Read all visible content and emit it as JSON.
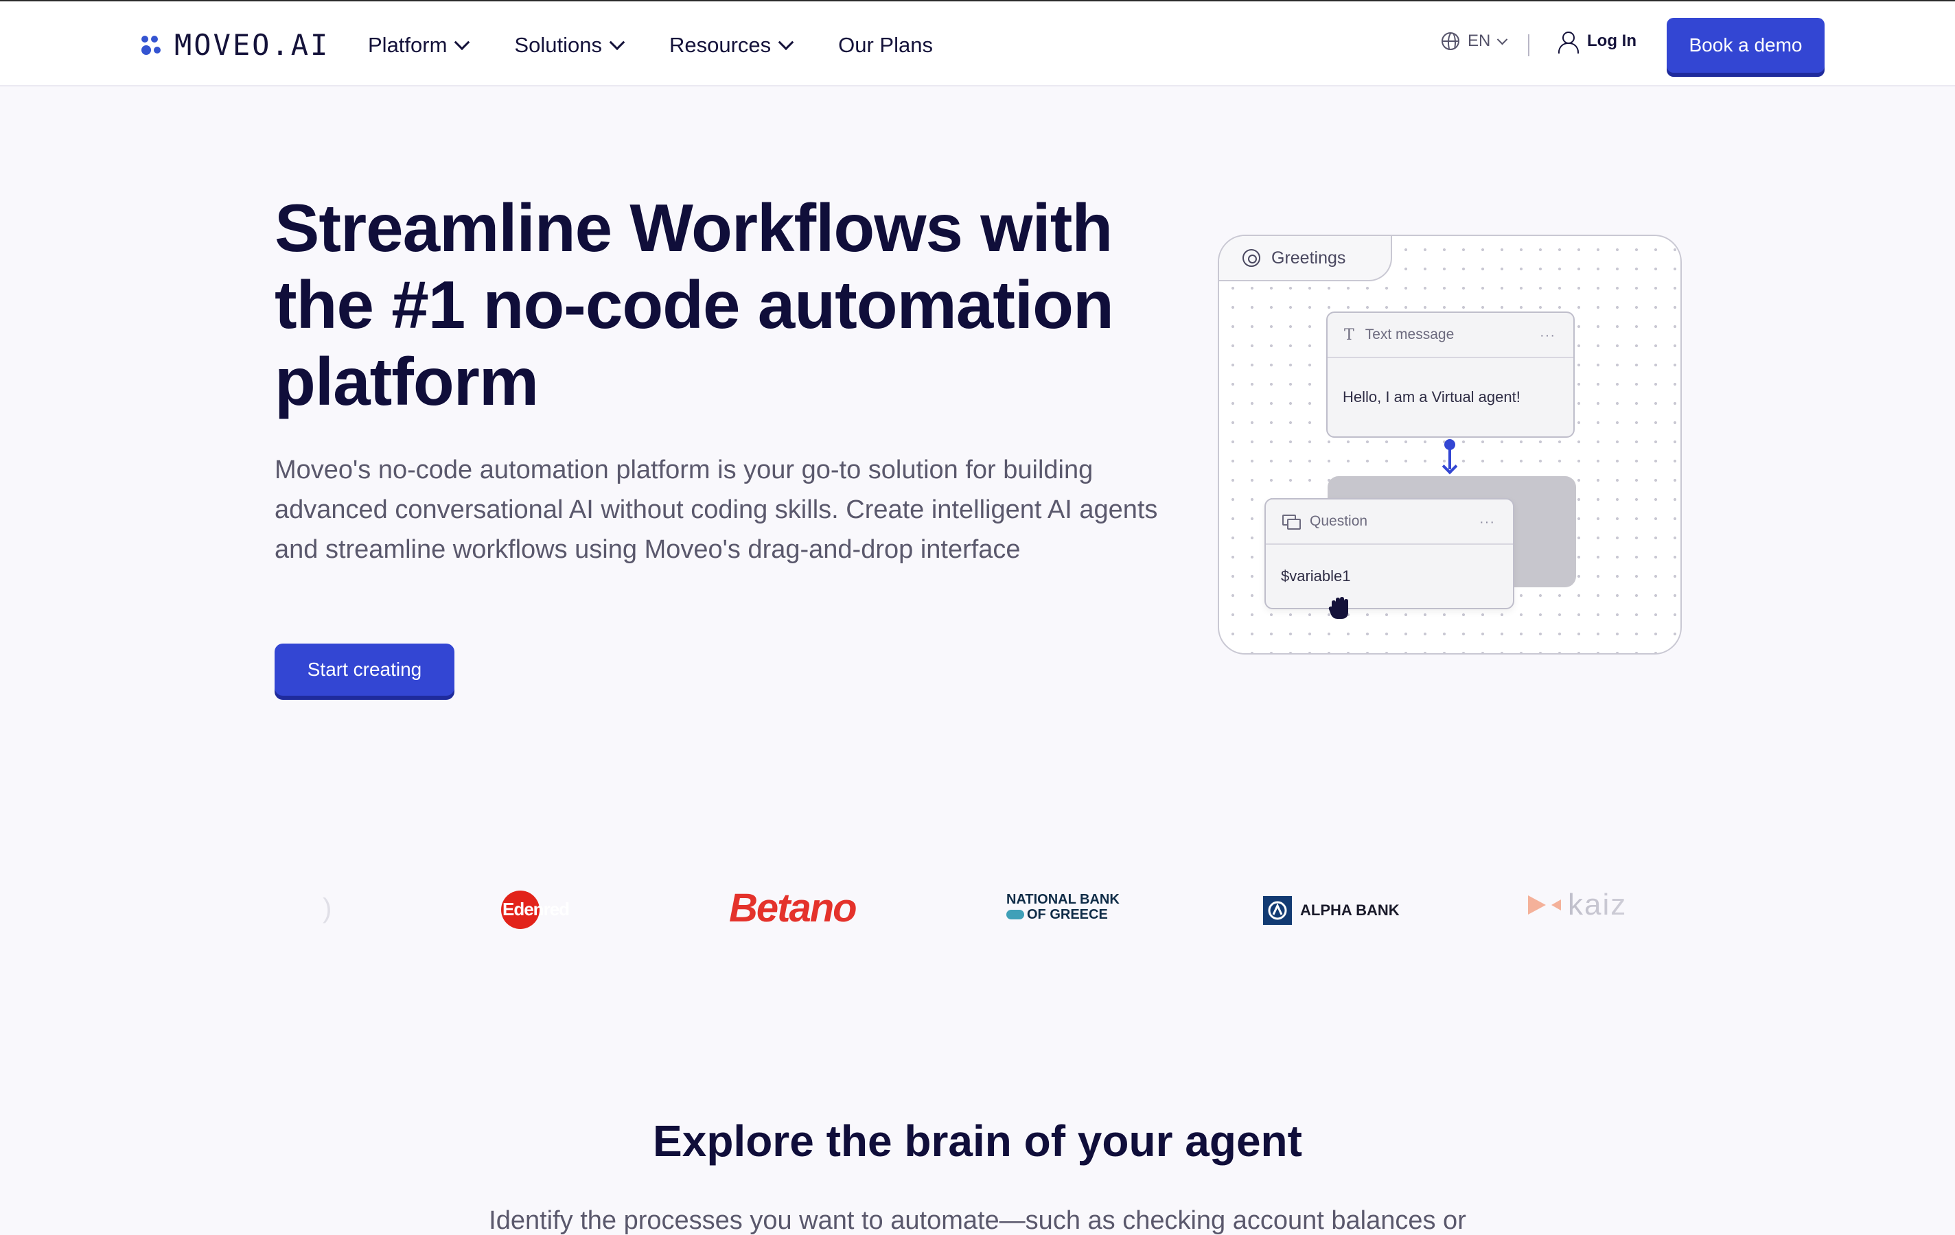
{
  "header": {
    "logo_text": "MOVEO.AI",
    "nav": [
      {
        "label": "Platform",
        "has_dropdown": true
      },
      {
        "label": "Solutions",
        "has_dropdown": true
      },
      {
        "label": "Resources",
        "has_dropdown": true
      },
      {
        "label": "Our Plans",
        "has_dropdown": false
      }
    ],
    "language": "EN",
    "login_label": "Log In",
    "cta_label": "Book a demo"
  },
  "hero": {
    "title": "Streamline Workflows with the #1 no-code automation platform",
    "description": "Moveo's no-code automation platform is your go-to solution for building advanced conversational AI without coding skills. Create intelligent AI agents and streamline workflows using Moveo's drag-and-drop interface",
    "cta_label": "Start creating"
  },
  "flow": {
    "tab_label": "Greetings",
    "text_node": {
      "title": "Text message",
      "body": "Hello, I am a Virtual agent!",
      "menu": "···"
    },
    "question_node": {
      "title": "Question",
      "body": "$variable1",
      "menu": "···"
    }
  },
  "logos": {
    "items": [
      {
        "name": "Edenred",
        "text": "Edenred"
      },
      {
        "name": "Betano",
        "text": "Betano"
      },
      {
        "name": "National Bank of Greece",
        "line1": "NATIONAL BANK",
        "line2": "OF GREECE"
      },
      {
        "name": "Alpha Bank",
        "text": "ALPHA BANK"
      },
      {
        "name": "kaiz",
        "text": "kaiz"
      }
    ]
  },
  "explore": {
    "title": "Explore the brain of your agent",
    "description": "Identify the processes you want to automate—such as checking account balances or"
  },
  "colors": {
    "primary": "#3346d3",
    "heading": "#100e3a",
    "body_text": "#5a586c",
    "background": "#f9f8fc",
    "betano": "#e4322b",
    "edenred": "#e2231a"
  },
  "icons": [
    "globe-icon",
    "user-icon",
    "chevron-down-icon",
    "target-icon",
    "text-icon",
    "question-icon",
    "hand-cursor-icon"
  ]
}
